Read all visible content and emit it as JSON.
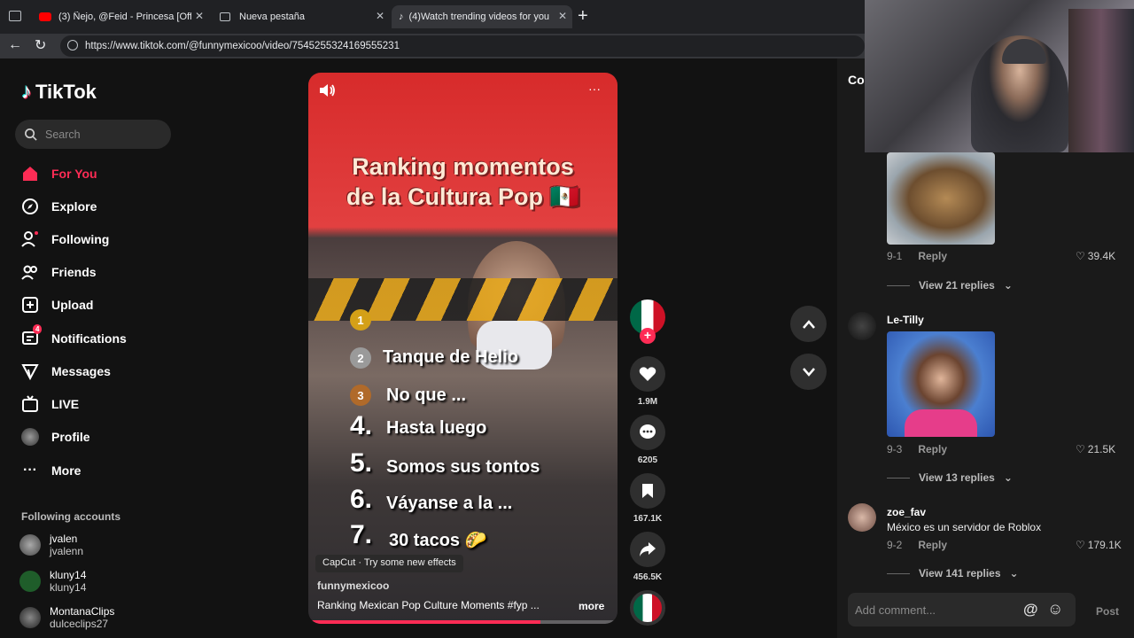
{
  "browser": {
    "tabs": [
      {
        "title": "(3) Ñejo, @Feid - Princesa [Officia",
        "active": false
      },
      {
        "title": "Nueva pestaña",
        "active": false
      },
      {
        "title": "(4)Watch trending videos for you",
        "active": true
      }
    ],
    "url": "https://www.tiktok.com/@funnymexicoo/video/7545255324169555231"
  },
  "sidebar": {
    "logo": "TikTok",
    "search_placeholder": "Search",
    "nav": [
      {
        "label": "For You",
        "icon": "home-icon",
        "active": true
      },
      {
        "label": "Explore",
        "icon": "compass-icon"
      },
      {
        "label": "Following",
        "icon": "following-icon"
      },
      {
        "label": "Friends",
        "icon": "friends-icon"
      },
      {
        "label": "Upload",
        "icon": "upload-icon"
      },
      {
        "label": "Notifications",
        "icon": "notifications-icon",
        "badge": "4"
      },
      {
        "label": "Messages",
        "icon": "messages-icon"
      },
      {
        "label": "LIVE",
        "icon": "live-icon"
      },
      {
        "label": "Profile",
        "icon": "profile-icon"
      },
      {
        "label": "More",
        "icon": "more-icon"
      }
    ],
    "following_title": "Following accounts",
    "accounts": [
      {
        "name": "jvalen",
        "handle": "jvalenn"
      },
      {
        "name": "kluny14",
        "handle": "kluny14"
      },
      {
        "name": "MontanaClips",
        "handle": "dulceclips27"
      }
    ]
  },
  "video": {
    "title_line1": "Ranking momentos",
    "title_line2": "de la Cultura Pop 🇲🇽",
    "ranks": [
      {
        "num": "1",
        "text": ""
      },
      {
        "num": "2",
        "text": "Tanque de Helio"
      },
      {
        "num": "3",
        "text": "No que ..."
      },
      {
        "num": "4.",
        "text": "Hasta luego"
      },
      {
        "num": "5.",
        "text": "Somos sus tontos"
      },
      {
        "num": "6.",
        "text": "Váyanse a la ..."
      },
      {
        "num": "7.",
        "text": "30 tacos 🌮"
      }
    ],
    "capcut": "CapCut · Try some new effects",
    "author": "funnymexicoo",
    "description": "Ranking Mexican Pop Culture Moments #fyp ...",
    "more": "more",
    "progress": 0.75
  },
  "actions": {
    "likes": "1.9M",
    "comments": "6205",
    "saves": "167.1K",
    "shares": "456.5K"
  },
  "comments": {
    "header": "Co",
    "items": [
      {
        "date": "9-1",
        "reply": "Reply",
        "likes": "39.4K",
        "view": "View 21 replies"
      },
      {
        "user": "Le-Tilly",
        "date": "9-3",
        "reply": "Reply",
        "likes": "21.5K",
        "view": "View 13 replies"
      },
      {
        "user": "zoe_fav",
        "text": "México es un servidor de Roblox",
        "date": "9-2",
        "reply": "Reply",
        "likes": "179.1K",
        "view": "View 141 replies"
      }
    ],
    "input_placeholder": "Add comment...",
    "post": "Post"
  }
}
